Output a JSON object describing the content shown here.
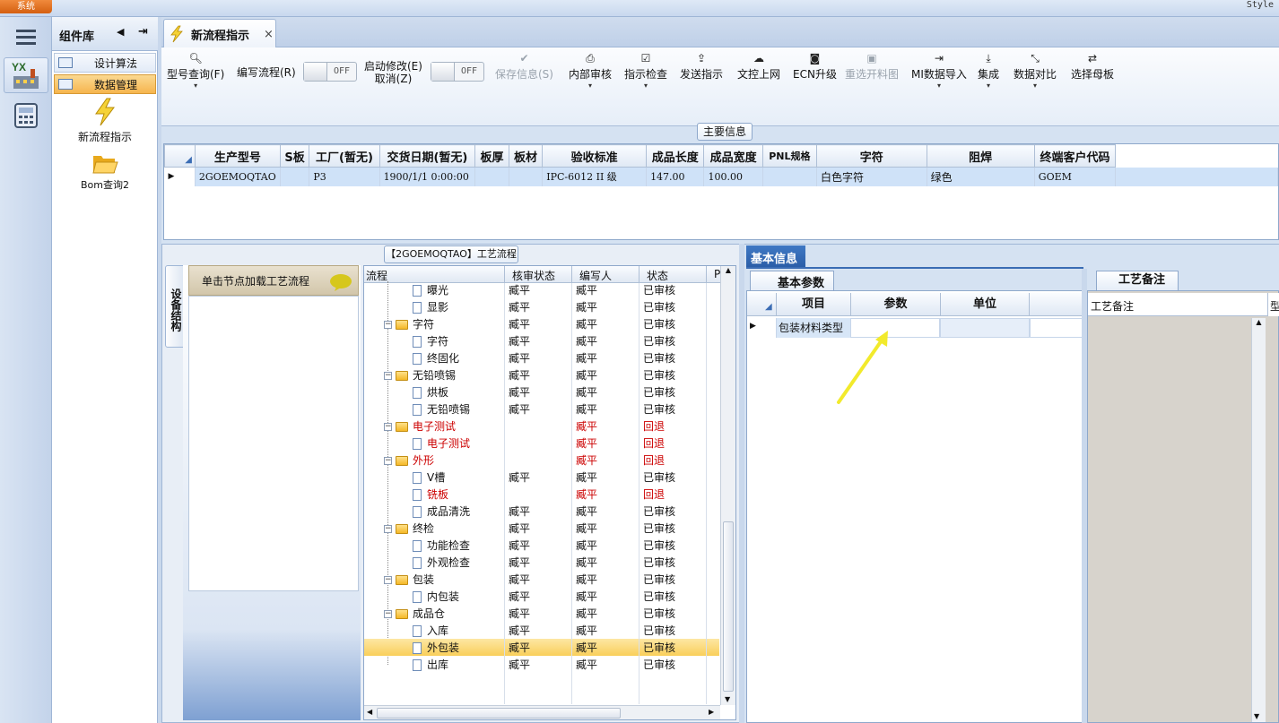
{
  "app": {
    "system_button": "系统",
    "style_label": "Style"
  },
  "leftnav": {
    "icons": [
      "menu-icon",
      "yx-factory-icon",
      "calculator-icon"
    ],
    "yx_text": "YX"
  },
  "component_library": {
    "title": "组件库",
    "items": [
      {
        "label": "设计算法",
        "selected": false
      },
      {
        "label": "数据管理",
        "selected": true
      }
    ],
    "tools": [
      {
        "label": "新流程指示",
        "icon": "lightning-icon"
      },
      {
        "label": "Bom查询2",
        "icon": "folder-open-icon"
      }
    ]
  },
  "tab": {
    "label": "新流程指示",
    "close": "×"
  },
  "toolbar": {
    "buttons": [
      {
        "label": "型号查询(F)",
        "icon": "search-icon",
        "dropdown": true,
        "disabled": false
      },
      {
        "label": "编写流程(R)",
        "icon": "",
        "dropdown": false,
        "disabled": false
      },
      {
        "label": "保存信息(S)",
        "icon": "check-icon",
        "dropdown": false,
        "disabled": true
      },
      {
        "label": "内部审核",
        "icon": "print-icon",
        "dropdown": true,
        "disabled": false
      },
      {
        "label": "指示检查",
        "icon": "checkbox-icon",
        "dropdown": true,
        "disabled": false
      },
      {
        "label": "发送指示",
        "icon": "upload-icon",
        "dropdown": false,
        "disabled": false
      },
      {
        "label": "文控上网",
        "icon": "cloud-upload-icon",
        "dropdown": false,
        "disabled": false
      },
      {
        "label": "ECN升级",
        "icon": "binoculars-icon",
        "dropdown": false,
        "disabled": false
      },
      {
        "label": "重选开料图",
        "icon": "image-icon",
        "dropdown": false,
        "disabled": true
      },
      {
        "label": "MI数据导入",
        "icon": "sign-in-icon",
        "dropdown": true,
        "disabled": false
      },
      {
        "label": "集成",
        "icon": "download-icon",
        "dropdown": true,
        "disabled": false
      },
      {
        "label": "数据对比",
        "icon": "compress-icon",
        "dropdown": true,
        "disabled": false
      },
      {
        "label": "选择母板",
        "icon": "shuffle-icon",
        "dropdown": false,
        "disabled": false
      }
    ],
    "toggle_edit": {
      "off": "OFF"
    },
    "start_modify": {
      "line1": "启动修改(E)",
      "line2": "取消(Z)",
      "off": "OFF"
    }
  },
  "main_info": {
    "caption": "主要信息",
    "columns": [
      "生产型号",
      "S板",
      "工厂(暂无)",
      "交货日期(暂无)",
      "板厚",
      "板材",
      "验收标准",
      "成品长度",
      "成品宽度",
      "PNL规格",
      "字符",
      "阻焊",
      "终端客户代码"
    ],
    "rows": [
      [
        "2GOEMOQTAO",
        "",
        "P3",
        "1900/1/1 0:00:00",
        "",
        "",
        "IPC-6012 II 级",
        "147.00",
        "100.00",
        "",
        "白色字符",
        "绿色",
        "GOEM"
      ]
    ]
  },
  "process_panel": {
    "caption": "【2GOEMOQTAO】工艺流程",
    "side_tab": "设备结构",
    "hint": "单击节点加载工艺流程",
    "columns": [
      "流程",
      "核审状态",
      "编写人",
      "状态",
      "PI"
    ],
    "rows": [
      {
        "name": "曝光",
        "level": 2,
        "folder": false,
        "review": "臧平",
        "author": "臧平",
        "status": "已审核",
        "red": false,
        "sel": false
      },
      {
        "name": "显影",
        "level": 2,
        "folder": false,
        "review": "臧平",
        "author": "臧平",
        "status": "已审核",
        "red": false,
        "sel": false
      },
      {
        "name": "字符",
        "level": 1,
        "folder": true,
        "review": "臧平",
        "author": "臧平",
        "status": "已审核",
        "red": false,
        "sel": false
      },
      {
        "name": "字符",
        "level": 2,
        "folder": false,
        "review": "臧平",
        "author": "臧平",
        "status": "已审核",
        "red": false,
        "sel": false
      },
      {
        "name": "终固化",
        "level": 2,
        "folder": false,
        "review": "臧平",
        "author": "臧平",
        "status": "已审核",
        "red": false,
        "sel": false
      },
      {
        "name": "无铅喷锡",
        "level": 1,
        "folder": true,
        "review": "臧平",
        "author": "臧平",
        "status": "已审核",
        "red": false,
        "sel": false
      },
      {
        "name": "烘板",
        "level": 2,
        "folder": false,
        "review": "臧平",
        "author": "臧平",
        "status": "已审核",
        "red": false,
        "sel": false
      },
      {
        "name": "无铅喷锡",
        "level": 2,
        "folder": false,
        "review": "臧平",
        "author": "臧平",
        "status": "已审核",
        "red": false,
        "sel": false
      },
      {
        "name": "电子测试",
        "level": 1,
        "folder": true,
        "review": "",
        "author": "臧平",
        "status": "回退",
        "red": true,
        "sel": false
      },
      {
        "name": "电子测试",
        "level": 2,
        "folder": false,
        "review": "",
        "author": "臧平",
        "status": "回退",
        "red": true,
        "sel": false
      },
      {
        "name": "外形",
        "level": 1,
        "folder": true,
        "review": "",
        "author": "臧平",
        "status": "回退",
        "red": true,
        "sel": false
      },
      {
        "name": "V槽",
        "level": 2,
        "folder": false,
        "review": "臧平",
        "author": "臧平",
        "status": "已审核",
        "red": false,
        "sel": false
      },
      {
        "name": "铣板",
        "level": 2,
        "folder": false,
        "review": "",
        "author": "臧平",
        "status": "回退",
        "red": true,
        "sel": false
      },
      {
        "name": "成品清洗",
        "level": 2,
        "folder": false,
        "review": "臧平",
        "author": "臧平",
        "status": "已审核",
        "red": false,
        "sel": false
      },
      {
        "name": "终检",
        "level": 1,
        "folder": true,
        "review": "臧平",
        "author": "臧平",
        "status": "已审核",
        "red": false,
        "sel": false
      },
      {
        "name": "功能检查",
        "level": 2,
        "folder": false,
        "review": "臧平",
        "author": "臧平",
        "status": "已审核",
        "red": false,
        "sel": false
      },
      {
        "name": "外观检查",
        "level": 2,
        "folder": false,
        "review": "臧平",
        "author": "臧平",
        "status": "已审核",
        "red": false,
        "sel": false
      },
      {
        "name": "包装",
        "level": 1,
        "folder": true,
        "review": "臧平",
        "author": "臧平",
        "status": "已审核",
        "red": false,
        "sel": false
      },
      {
        "name": "内包装",
        "level": 2,
        "folder": false,
        "review": "臧平",
        "author": "臧平",
        "status": "已审核",
        "red": false,
        "sel": false
      },
      {
        "name": "成品仓",
        "level": 1,
        "folder": true,
        "review": "臧平",
        "author": "臧平",
        "status": "已审核",
        "red": false,
        "sel": false
      },
      {
        "name": "入库",
        "level": 2,
        "folder": false,
        "review": "臧平",
        "author": "臧平",
        "status": "已审核",
        "red": false,
        "sel": false
      },
      {
        "name": "外包装",
        "level": 2,
        "folder": false,
        "review": "臧平",
        "author": "臧平",
        "status": "已审核",
        "red": false,
        "sel": true
      },
      {
        "name": "出库",
        "level": 2,
        "folder": false,
        "review": "臧平",
        "author": "臧平",
        "status": "已审核",
        "red": false,
        "sel": false
      }
    ]
  },
  "basic_info": {
    "tab": "基本信息",
    "subtab": "基本参数",
    "columns": [
      "项目",
      "参数",
      "单位"
    ],
    "rows": [
      [
        "包装材料类型",
        "",
        ""
      ]
    ]
  },
  "process_notes": {
    "tab": "工艺备注",
    "column": "工艺备注",
    "extra_col": "型"
  },
  "colors": {
    "accent": "#3a6cb4",
    "selected": "#f9cf5a",
    "red": "#cc0000",
    "arrow": "#f2ea2c"
  }
}
